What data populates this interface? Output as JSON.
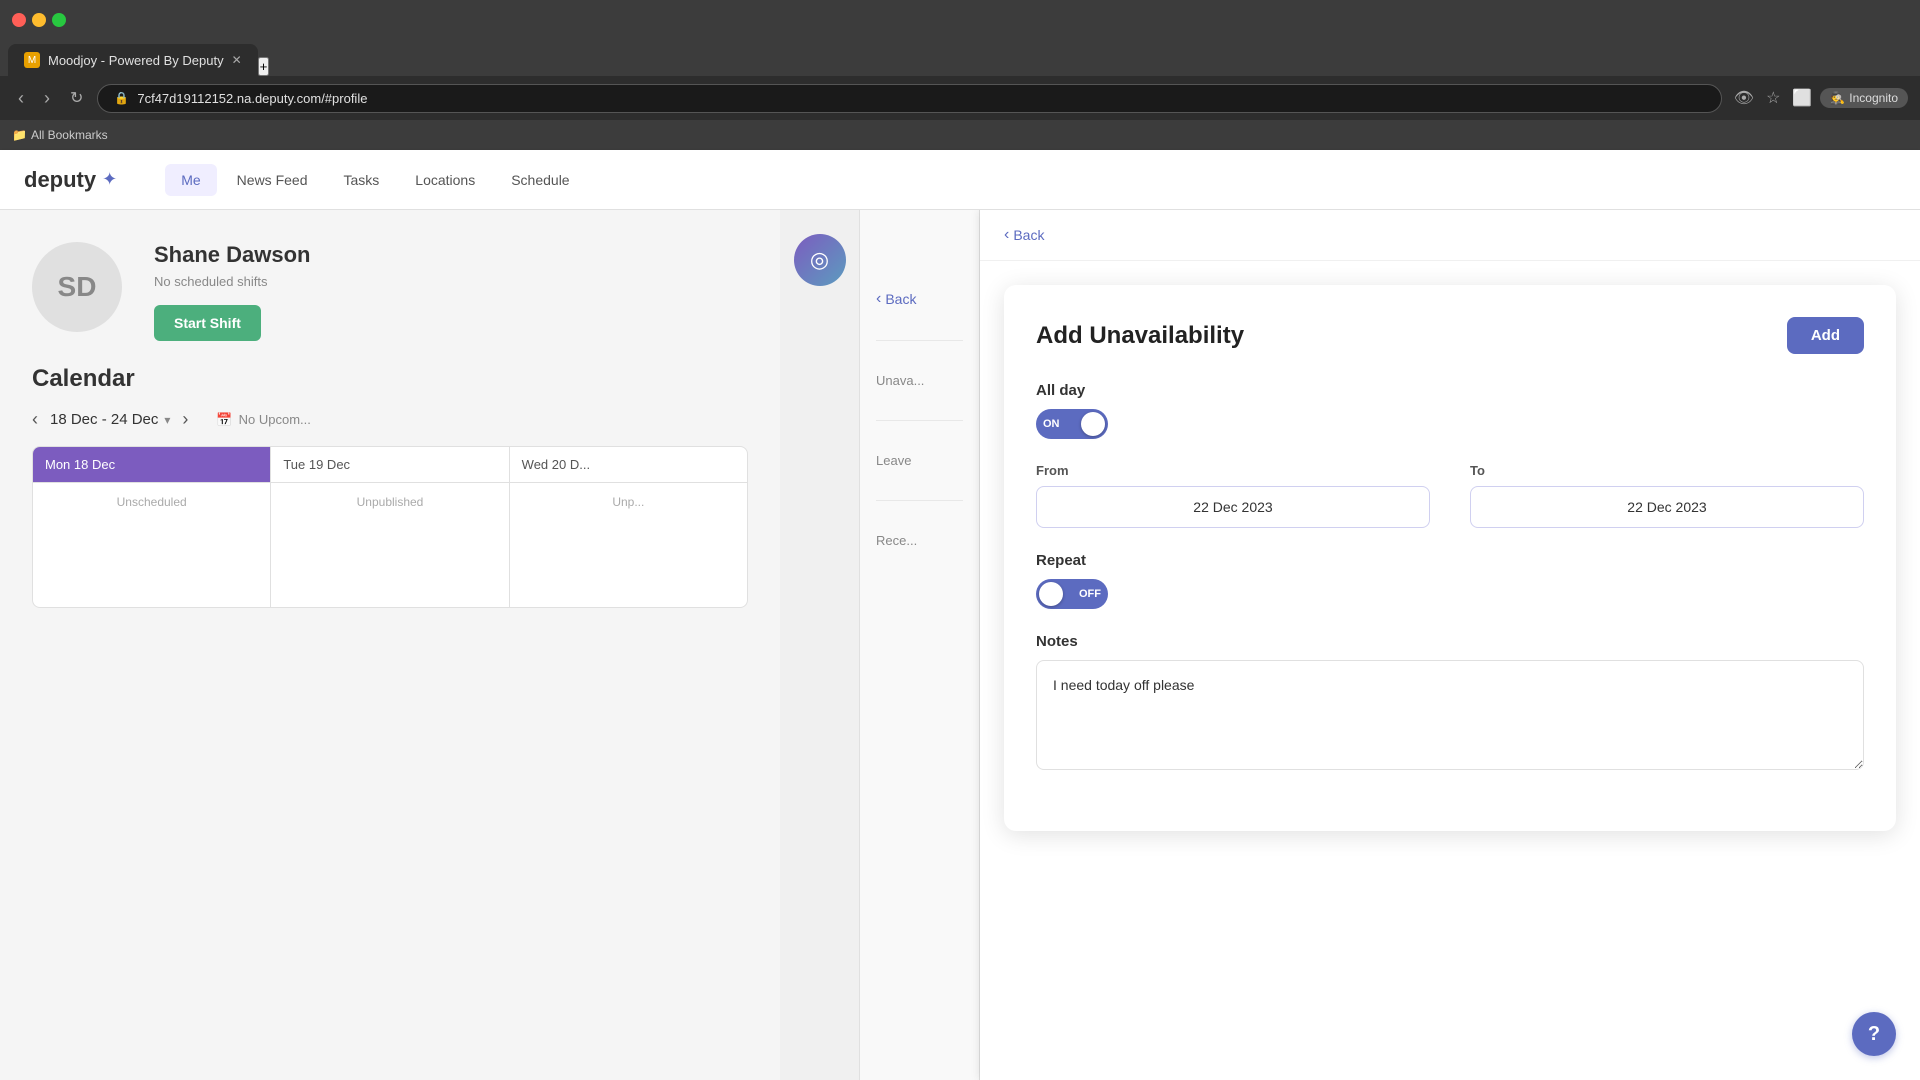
{
  "browser": {
    "tab_title": "Moodjoy - Powered By Deputy",
    "url": "7cf47d19112152.na.deputy.com/#profile",
    "incognito_label": "Incognito",
    "bookmarks_label": "All Bookmarks"
  },
  "nav": {
    "logo": "deputy",
    "links": [
      {
        "label": "Me",
        "active": true
      },
      {
        "label": "News Feed",
        "active": false
      },
      {
        "label": "Tasks",
        "active": false
      },
      {
        "label": "Locations",
        "active": false
      },
      {
        "label": "Schedule",
        "active": false
      }
    ]
  },
  "profile": {
    "initials": "SD",
    "name": "Shane Dawson",
    "status": "No scheduled shifts",
    "start_shift_label": "Start Shift"
  },
  "calendar": {
    "title": "Calendar",
    "date_range": "18 Dec - 24 Dec",
    "upcoming_label": "No Upcom...",
    "days": [
      {
        "label": "Mon 18 Dec",
        "today": true,
        "body": "Unscheduled"
      },
      {
        "label": "Tue 19 Dec",
        "today": false,
        "body": "Unpublished"
      },
      {
        "label": "Wed 20 D...",
        "today": false,
        "body": "Unp..."
      }
    ]
  },
  "back_buttons": {
    "back1_label": "Back",
    "back2_label": "Back"
  },
  "side_sections": {
    "unavailability_label": "Unava...",
    "leave_label": "Leave",
    "recent_label": "Rece..."
  },
  "modal": {
    "title": "Add Unavailability",
    "add_button_label": "Add",
    "all_day": {
      "label": "All day",
      "toggle_state": "ON",
      "is_on": true
    },
    "from": {
      "label": "From",
      "value": "22 Dec 2023"
    },
    "to": {
      "label": "To",
      "value": "22 Dec 2023"
    },
    "repeat": {
      "label": "Repeat",
      "toggle_state": "OFF",
      "is_on": false
    },
    "notes": {
      "label": "Notes",
      "value": "I need today off please"
    }
  },
  "help": {
    "icon": "?"
  }
}
